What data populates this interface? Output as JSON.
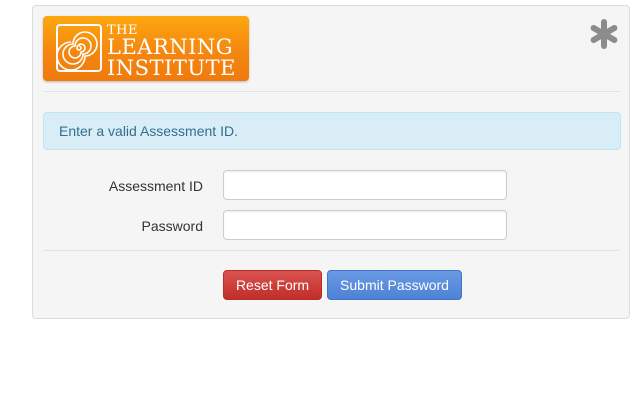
{
  "logo": {
    "line1": "THE",
    "line2": "LEARNING",
    "line3": "INSTITUTE"
  },
  "close_icon": "asterisk-close-icon",
  "alert": {
    "message": "Enter a valid Assessment ID."
  },
  "form": {
    "assessment_id_label": "Assessment ID",
    "assessment_id_value": "",
    "password_label": "Password",
    "password_value": ""
  },
  "buttons": {
    "reset_label": "Reset Form",
    "submit_label": "Submit Password"
  },
  "colors": {
    "logo_orange": "#f58710",
    "alert_bg": "#d9edf7",
    "alert_text": "#31708f",
    "danger": "#d9534f",
    "primary": "#5b8ede"
  }
}
